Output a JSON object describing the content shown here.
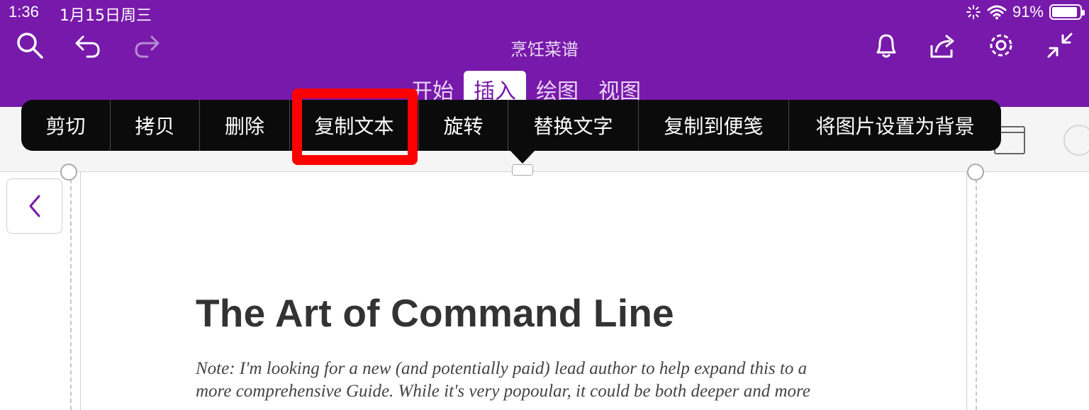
{
  "status_bar": {
    "time": "1:36",
    "date": "1月15日周三",
    "battery": "91%",
    "battery_level": 0.91
  },
  "header": {
    "title": "烹饪菜谱",
    "tabs": [
      {
        "label": "开始",
        "active": false
      },
      {
        "label": "插入",
        "active": true
      },
      {
        "label": "绘图",
        "active": false
      },
      {
        "label": "视图",
        "active": false
      }
    ],
    "icons": [
      "search-icon",
      "undo-icon",
      "redo-icon",
      "bell-icon",
      "share-icon",
      "gear-icon",
      "collapse-icon"
    ]
  },
  "context_menu": {
    "items": [
      "剪切",
      "拷贝",
      "删除",
      "复制文本",
      "旋转",
      "替换文字",
      "复制到便笺",
      "将图片设置为背景"
    ],
    "highlighted": "复制文本"
  },
  "page": {
    "heading": "The Art of Command Line",
    "note": "Note: I'm looking for a new (and potentially paid) lead author to help expand this to a more comprehensive Guide. While it's very popoular, it could be both deeper and more"
  },
  "colors": {
    "brand": "#7719aa",
    "highlight": "#ff0000",
    "menu_bg": "#0b0b0b"
  }
}
